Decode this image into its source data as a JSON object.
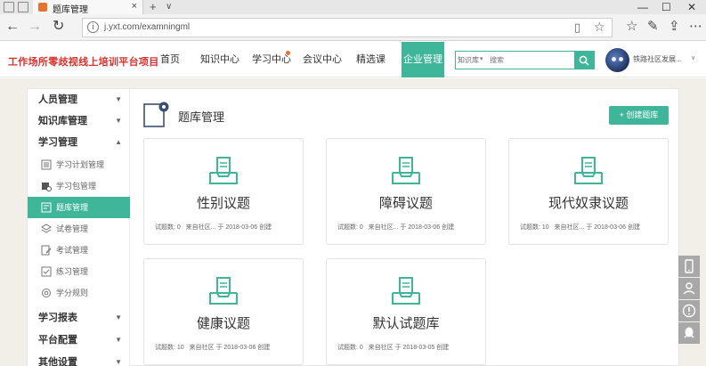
{
  "browser": {
    "tab_title": "题库管理",
    "url": "j.yxt.com/examningml"
  },
  "site": {
    "logo_text": "工作场所零歧视线上培训平台项目",
    "nav": [
      "首页",
      "知识中心",
      "学习中心",
      "会议中心",
      "精选课",
      "企业管理"
    ],
    "active_nav": "企业管理",
    "search_select": "知识库",
    "search_placeholder": "搜索",
    "user_name": "铁路社区发展..."
  },
  "sidebar": {
    "sections": [
      {
        "label": "人员管理",
        "expanded": false
      },
      {
        "label": "知识库管理",
        "expanded": false
      },
      {
        "label": "学习管理",
        "expanded": true
      },
      {
        "label": "学习报表",
        "expanded": false
      },
      {
        "label": "平台配置",
        "expanded": false
      },
      {
        "label": "其他设置",
        "expanded": false
      }
    ],
    "sub_items": [
      {
        "label": "学习计划管理",
        "icon": "list-icon"
      },
      {
        "label": "学习包管理",
        "icon": "package-gear-icon"
      },
      {
        "label": "题库管理",
        "icon": "question-bank-icon",
        "active": true
      },
      {
        "label": "试卷管理",
        "icon": "layers-icon"
      },
      {
        "label": "考试管理",
        "icon": "exam-edit-icon"
      },
      {
        "label": "练习管理",
        "icon": "practice-icon"
      },
      {
        "label": "学分规则",
        "icon": "settings-gear-icon"
      }
    ]
  },
  "main": {
    "title": "题库管理",
    "create_button": "+ 创建题库",
    "cards": [
      {
        "name": "性别议题",
        "count_label": "试题数:",
        "count": "0",
        "meta": "来自社区... 于 2018-03-06 创建"
      },
      {
        "name": "障碍议题",
        "count_label": "试题数:",
        "count": "0",
        "meta": "来自社区... 于 2018-03-06 创建"
      },
      {
        "name": "现代奴隶议题",
        "count_label": "试题数:",
        "count": "10",
        "meta": "来自社区... 于 2018-03-06 创建"
      },
      {
        "name": "健康议题",
        "count_label": "试题数:",
        "count": "10",
        "meta": "来自社区 于 2018-03-06 创建"
      },
      {
        "name": "默认试题库",
        "count_label": "试题数:",
        "count": "0",
        "meta": "来自社区 于 2018-03-05 创建"
      }
    ]
  },
  "colors": {
    "accent": "#3fb59a",
    "logo": "#d9302b"
  }
}
